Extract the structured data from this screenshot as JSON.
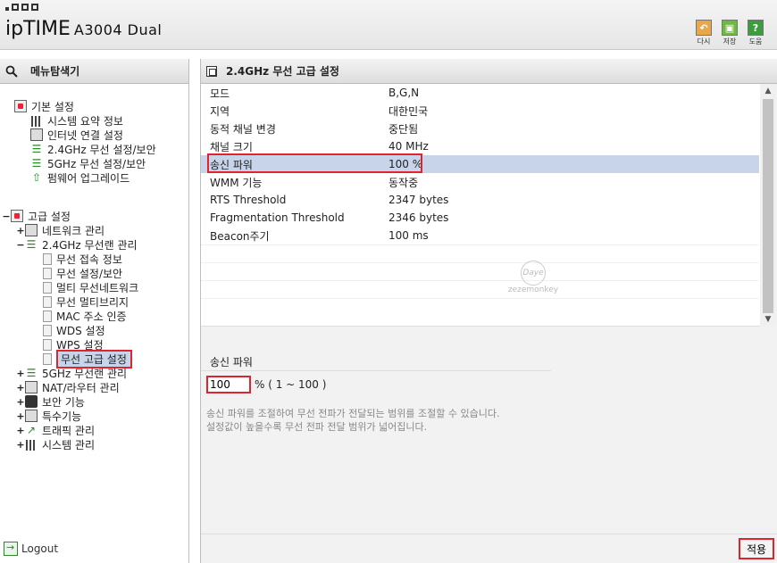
{
  "header": {
    "brand": "ipTIME",
    "model": "A3004 Dual",
    "buttons": [
      {
        "label": "다시",
        "icon": "undo-icon",
        "color": "#e8a84a"
      },
      {
        "label": "저장",
        "icon": "save-icon",
        "color": "#6dbb3a"
      },
      {
        "label": "도움",
        "icon": "help-icon",
        "color": "#3f9b3f"
      }
    ]
  },
  "left": {
    "title": "메뉴탐색기",
    "tree": [
      {
        "label": "기본 설정",
        "icon": "folder-icon",
        "toggle": ""
      },
      {
        "label": "시스템 요약 정보",
        "icon": "chart-icon",
        "toggle": ""
      },
      {
        "label": "인터넷 연결 설정",
        "icon": "monitor-icon",
        "toggle": ""
      },
      {
        "label": "2.4GHz 무선 설정/보안",
        "icon": "wifi-icon",
        "toggle": ""
      },
      {
        "label": "5GHz 무선 설정/보안",
        "icon": "wifi-icon",
        "toggle": ""
      },
      {
        "label": "펌웨어 업그레이드",
        "icon": "upgrade-icon",
        "toggle": ""
      },
      {
        "label": "고급 설정",
        "icon": "folder-icon",
        "toggle": "−"
      },
      {
        "label": "네트워크 관리",
        "icon": "network-icon",
        "toggle": "+"
      },
      {
        "label": "2.4GHz 무선랜 관리",
        "icon": "wifi-icon",
        "toggle": "−"
      },
      {
        "label": "무선 접속 정보",
        "icon": "page-icon",
        "toggle": ""
      },
      {
        "label": "무선 설정/보안",
        "icon": "page-icon",
        "toggle": ""
      },
      {
        "label": "멀티 무선네트워크",
        "icon": "page-icon",
        "toggle": ""
      },
      {
        "label": "무선 멀티브리지",
        "icon": "page-icon",
        "toggle": ""
      },
      {
        "label": "MAC 주소 인증",
        "icon": "page-icon",
        "toggle": ""
      },
      {
        "label": "WDS 설정",
        "icon": "page-icon",
        "toggle": ""
      },
      {
        "label": "WPS 설정",
        "icon": "page-icon",
        "toggle": ""
      },
      {
        "label": "무선 고급 설정",
        "icon": "page-icon",
        "toggle": ""
      },
      {
        "label": "5GHz 무선랜 관리",
        "icon": "wifi-icon",
        "toggle": "+"
      },
      {
        "label": "NAT/라우터 관리",
        "icon": "router-icon",
        "toggle": "+"
      },
      {
        "label": "보안 기능",
        "icon": "lock-icon",
        "toggle": "+"
      },
      {
        "label": "특수기능",
        "icon": "special-icon",
        "toggle": "+"
      },
      {
        "label": "트래픽 관리",
        "icon": "traffic-icon",
        "toggle": "+"
      },
      {
        "label": "시스템 관리",
        "icon": "chart-icon",
        "toggle": "+"
      }
    ],
    "logout": "Logout"
  },
  "right": {
    "title": "2.4GHz 무선 고급 설정",
    "rows": [
      {
        "key": "모드",
        "value": "B,G,N"
      },
      {
        "key": "지역",
        "value": "대한민국"
      },
      {
        "key": "동적 채널 변경",
        "value": "중단됨"
      },
      {
        "key": "채널 크기",
        "value": "40 MHz"
      },
      {
        "key": "송신 파워",
        "value": "100 %"
      },
      {
        "key": "WMM 기능",
        "value": "동작중"
      },
      {
        "key": "RTS Threshold",
        "value": "2347 bytes"
      },
      {
        "key": "Fragmentation Threshold",
        "value": "2346 bytes"
      },
      {
        "key": "Beacon주기",
        "value": "100 ms"
      }
    ],
    "section_label": "송신 파워",
    "power_value": "100",
    "power_unit": "% ( 1 ~ 100 )",
    "desc1": "송신 파워를 조절하여 무선 전파가 전달되는 범위를 조절할 수 있습니다.",
    "desc2": "설정값이 높을수록 무선 전파 전달 범위가 넓어집니다.",
    "apply_label": "적용",
    "watermark_top": "Daye",
    "watermark_bottom": "zezemonkey"
  }
}
